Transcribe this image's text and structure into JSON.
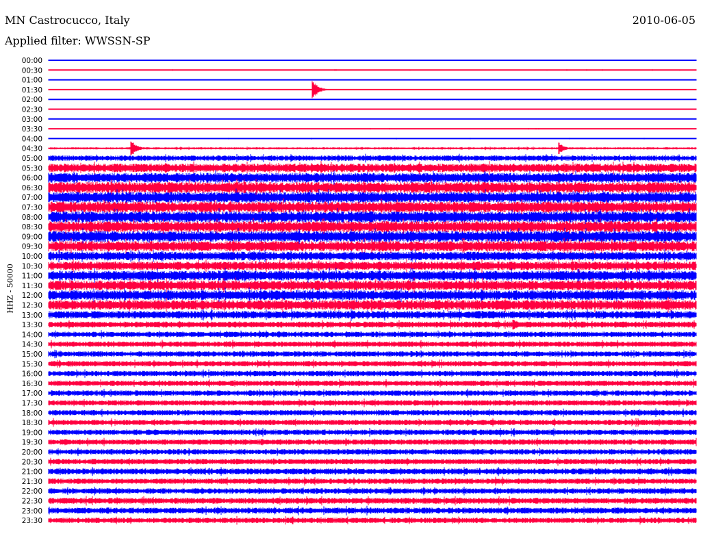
{
  "header": {
    "station": "MN Castrocucco, Italy",
    "filter": "Applied filter: WWSSN-SP",
    "date": "2010-06-05"
  },
  "chart_data": {
    "type": "line",
    "title": "MN Castrocucco, Italy",
    "ylabel": "HHZ - 50000",
    "row_minutes": 30,
    "colors": [
      "#0000ff",
      "#ff0040"
    ],
    "rows": [
      {
        "time": "00:00",
        "amp": 0.06
      },
      {
        "time": "00:30",
        "amp": 0.1
      },
      {
        "time": "01:00",
        "amp": 0.06
      },
      {
        "time": "01:30",
        "amp": 0.06
      },
      {
        "time": "02:00",
        "amp": 0.08
      },
      {
        "time": "02:30",
        "amp": 0.06
      },
      {
        "time": "03:00",
        "amp": 0.06
      },
      {
        "time": "03:30",
        "amp": 0.1
      },
      {
        "time": "04:00",
        "amp": 0.1
      },
      {
        "time": "04:30",
        "amp": 0.2
      },
      {
        "time": "05:00",
        "amp": 0.5
      },
      {
        "time": "05:30",
        "amp": 0.8
      },
      {
        "time": "06:00",
        "amp": 0.9
      },
      {
        "time": "06:30",
        "amp": 1.0
      },
      {
        "time": "07:00",
        "amp": 1.0
      },
      {
        "time": "07:30",
        "amp": 1.0
      },
      {
        "time": "08:00",
        "amp": 1.0
      },
      {
        "time": "08:30",
        "amp": 1.0
      },
      {
        "time": "09:00",
        "amp": 1.0
      },
      {
        "time": "09:30",
        "amp": 0.95
      },
      {
        "time": "10:00",
        "amp": 0.8
      },
      {
        "time": "10:30",
        "amp": 0.8
      },
      {
        "time": "11:00",
        "amp": 0.9
      },
      {
        "time": "11:30",
        "amp": 0.9
      },
      {
        "time": "12:00",
        "amp": 0.9
      },
      {
        "time": "12:30",
        "amp": 0.9
      },
      {
        "time": "13:00",
        "amp": 0.7
      },
      {
        "time": "13:30",
        "amp": 0.55
      },
      {
        "time": "14:00",
        "amp": 0.5
      },
      {
        "time": "14:30",
        "amp": 0.5
      },
      {
        "time": "15:00",
        "amp": 0.5
      },
      {
        "time": "15:30",
        "amp": 0.5
      },
      {
        "time": "16:00",
        "amp": 0.5
      },
      {
        "time": "16:30",
        "amp": 0.5
      },
      {
        "time": "17:00",
        "amp": 0.5
      },
      {
        "time": "17:30",
        "amp": 0.5
      },
      {
        "time": "18:00",
        "amp": 0.5
      },
      {
        "time": "18:30",
        "amp": 0.5
      },
      {
        "time": "19:00",
        "amp": 0.5
      },
      {
        "time": "19:30",
        "amp": 0.5
      },
      {
        "time": "20:00",
        "amp": 0.5
      },
      {
        "time": "20:30",
        "amp": 0.5
      },
      {
        "time": "21:00",
        "amp": 0.55
      },
      {
        "time": "21:30",
        "amp": 0.5
      },
      {
        "time": "22:00",
        "amp": 0.5
      },
      {
        "time": "22:30",
        "amp": 0.55
      },
      {
        "time": "23:00",
        "amp": 0.55
      },
      {
        "time": "23:30",
        "amp": 0.5
      }
    ],
    "events": [
      {
        "row": 3,
        "minute": 12.2,
        "amp": 2.2
      },
      {
        "row": 9,
        "minute": 3.8,
        "amp": 1.8
      },
      {
        "row": 9,
        "minute": 23.6,
        "amp": 1.3
      },
      {
        "row": 26,
        "minute": 14.0,
        "amp": 1.2
      },
      {
        "row": 27,
        "minute": 21.5,
        "amp": 1.1
      }
    ]
  }
}
